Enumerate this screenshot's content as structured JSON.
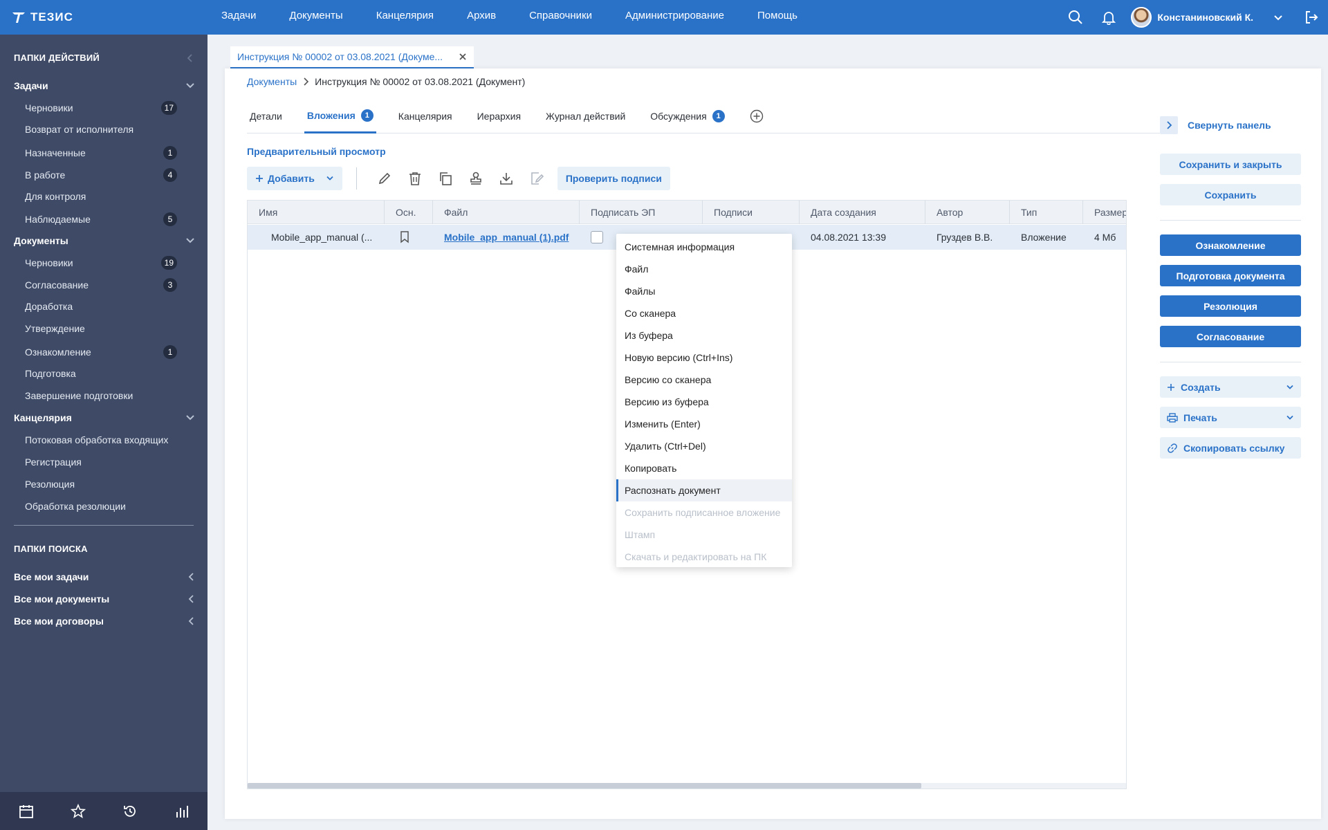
{
  "app": {
    "logo_text": "ТЕЗИС"
  },
  "topnav": [
    "Задачи",
    "Документы",
    "Канцелярия",
    "Архив",
    "Справочники",
    "Администрирование",
    "Помощь"
  ],
  "user": {
    "name": "Констаниновский К."
  },
  "sidebar": {
    "action_folders_title": "ПАПКИ ДЕЙСТВИЙ",
    "groups": [
      {
        "label": "Задачи",
        "items": [
          {
            "label": "Черновики",
            "count": "17"
          },
          {
            "label": "Возврат от исполнителя",
            "count": ""
          },
          {
            "label": "Назначенные",
            "count": "1"
          },
          {
            "label": "В работе",
            "count": "4"
          },
          {
            "label": "Для контроля",
            "count": ""
          },
          {
            "label": "Наблюдаемые",
            "count": "5"
          }
        ]
      },
      {
        "label": "Документы",
        "items": [
          {
            "label": "Черновики",
            "count": "19"
          },
          {
            "label": "Согласование",
            "count": "3"
          },
          {
            "label": "Доработка",
            "count": ""
          },
          {
            "label": "Утверждение",
            "count": ""
          },
          {
            "label": "Ознакомление",
            "count": "1"
          },
          {
            "label": "Подготовка",
            "count": ""
          },
          {
            "label": "Завершение подготовки",
            "count": ""
          }
        ]
      },
      {
        "label": "Канцелярия",
        "items": [
          {
            "label": "Потоковая обработка входящих",
            "count": ""
          },
          {
            "label": "Регистрация",
            "count": ""
          },
          {
            "label": "Резолюция",
            "count": ""
          },
          {
            "label": "Обработка резолюции",
            "count": ""
          }
        ]
      }
    ],
    "search_folders_title": "ПАПКИ ПОИСКА",
    "search_items": [
      "Все мои задачи",
      "Все мои документы",
      "Все мои договоры"
    ]
  },
  "doc_tab": {
    "title": "Инструкция № 00002 от 03.08.2021 (Докуме..."
  },
  "breadcrumb": {
    "root": "Документы",
    "current": "Инструкция № 00002 от 03.08.2021 (Документ)"
  },
  "tabs": [
    {
      "label": "Детали",
      "badge": ""
    },
    {
      "label": "Вложения",
      "badge": "1"
    },
    {
      "label": "Канцелярия",
      "badge": ""
    },
    {
      "label": "Иерархия",
      "badge": ""
    },
    {
      "label": "Журнал действий",
      "badge": ""
    },
    {
      "label": "Обсуждения",
      "badge": "1"
    }
  ],
  "preview_link": "Предварительный просмотр",
  "toolbar": {
    "add_label": "Добавить",
    "check_signatures_label": "Проверить подписи"
  },
  "grid": {
    "columns": [
      "Имя",
      "Осн.",
      "Файл",
      "Подписать ЭП",
      "Подписи",
      "Дата создания",
      "Автор",
      "Тип",
      "Размер"
    ],
    "rows": [
      {
        "name": "Mobile_app_manual (...",
        "file": "Mobile_app_manual (1).pdf",
        "signatures": "",
        "created": "04.08.2021 13:39",
        "author": "Груздев В.В.",
        "type": "Вложение",
        "size": "4 Мб"
      }
    ]
  },
  "context_menu": [
    {
      "label": "Системная информация",
      "state": "normal"
    },
    {
      "label": "Файл",
      "state": "normal"
    },
    {
      "label": "Файлы",
      "state": "normal"
    },
    {
      "label": "Со сканера",
      "state": "normal"
    },
    {
      "label": "Из буфера",
      "state": "normal"
    },
    {
      "label": "Новую версию (Ctrl+Ins)",
      "state": "normal"
    },
    {
      "label": "Версию со сканера",
      "state": "normal"
    },
    {
      "label": "Версию из буфера",
      "state": "normal"
    },
    {
      "label": "Изменить (Enter)",
      "state": "normal"
    },
    {
      "label": "Удалить (Ctrl+Del)",
      "state": "normal"
    },
    {
      "label": "Копировать",
      "state": "normal"
    },
    {
      "label": "Распознать документ",
      "state": "hover"
    },
    {
      "label": "Сохранить подписанное вложение",
      "state": "disabled"
    },
    {
      "label": "Штамп",
      "state": "disabled"
    },
    {
      "label": "Скачать и редактировать на ПК",
      "state": "disabled"
    }
  ],
  "right_panel": {
    "collapse_label": "Свернуть панель",
    "save_close_label": "Сохранить и закрыть",
    "save_label": "Сохранить",
    "actions": [
      "Ознакомление",
      "Подготовка документа",
      "Резолюция",
      "Согласование"
    ],
    "create_label": "Создать",
    "print_label": "Печать",
    "copy_link_label": "Скопировать ссылку"
  },
  "colors": {
    "brand": "#2a72c8",
    "sidebar": "#3e4a66",
    "badge": "#242c3f"
  }
}
